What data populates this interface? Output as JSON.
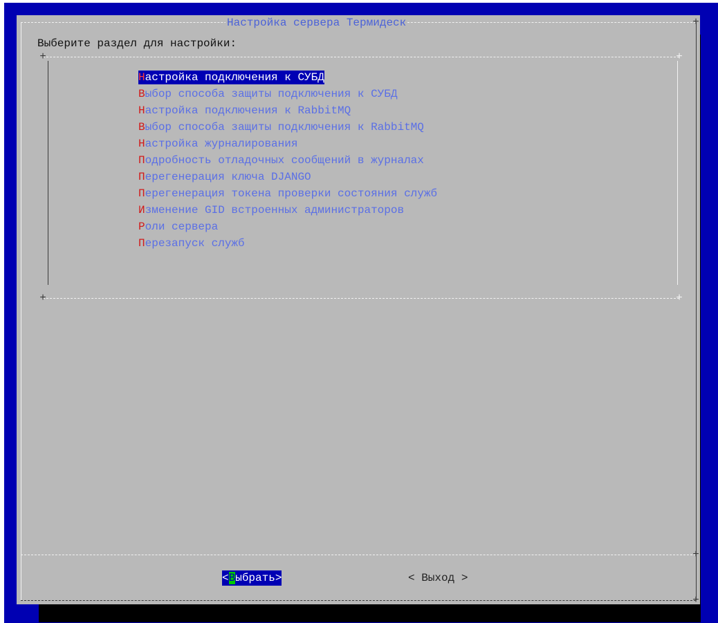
{
  "dialog": {
    "title": "Настройка сервера Термидеск",
    "prompt": "Выберите раздел для настройки:"
  },
  "menu": {
    "items": [
      {
        "hot": "Н",
        "rest": "астройка подключения к СУБД",
        "selected": true
      },
      {
        "hot": "В",
        "rest": "ыбор способа защиты подключения к СУБД",
        "selected": false
      },
      {
        "hot": "Н",
        "rest": "астройка подключения к RabbitMQ",
        "selected": false
      },
      {
        "hot": "В",
        "rest": "ыбор способа защиты подключения к RabbitMQ",
        "selected": false
      },
      {
        "hot": "Н",
        "rest": "астройка журналирования",
        "selected": false
      },
      {
        "hot": "П",
        "rest": "одробность отладочных сообщений в журналах",
        "selected": false
      },
      {
        "hot": "П",
        "rest": "ерегенерация ключа DJANGO",
        "selected": false
      },
      {
        "hot": "П",
        "rest": "ерегенерация токена проверки состояния служб",
        "selected": false
      },
      {
        "hot": "И",
        "rest": "зменение GID встроенных администраторов",
        "selected": false
      },
      {
        "hot": "Р",
        "rest": "оли сервера",
        "selected": false
      },
      {
        "hot": "П",
        "rest": "ерезапуск служб",
        "selected": false
      }
    ]
  },
  "buttons": {
    "ok": {
      "open": "<",
      "hot": "В",
      "rest": "ыбрать",
      "close": ">"
    },
    "exit": {
      "label": "< Выход >"
    }
  },
  "colors": {
    "background": "#0000b2",
    "dialog": "#b9b9b9",
    "highlight": "#0000b4",
    "menu_text": "#5a6fe6",
    "hotkey": "#d11a1a",
    "button_hotkey": "#00c800"
  }
}
